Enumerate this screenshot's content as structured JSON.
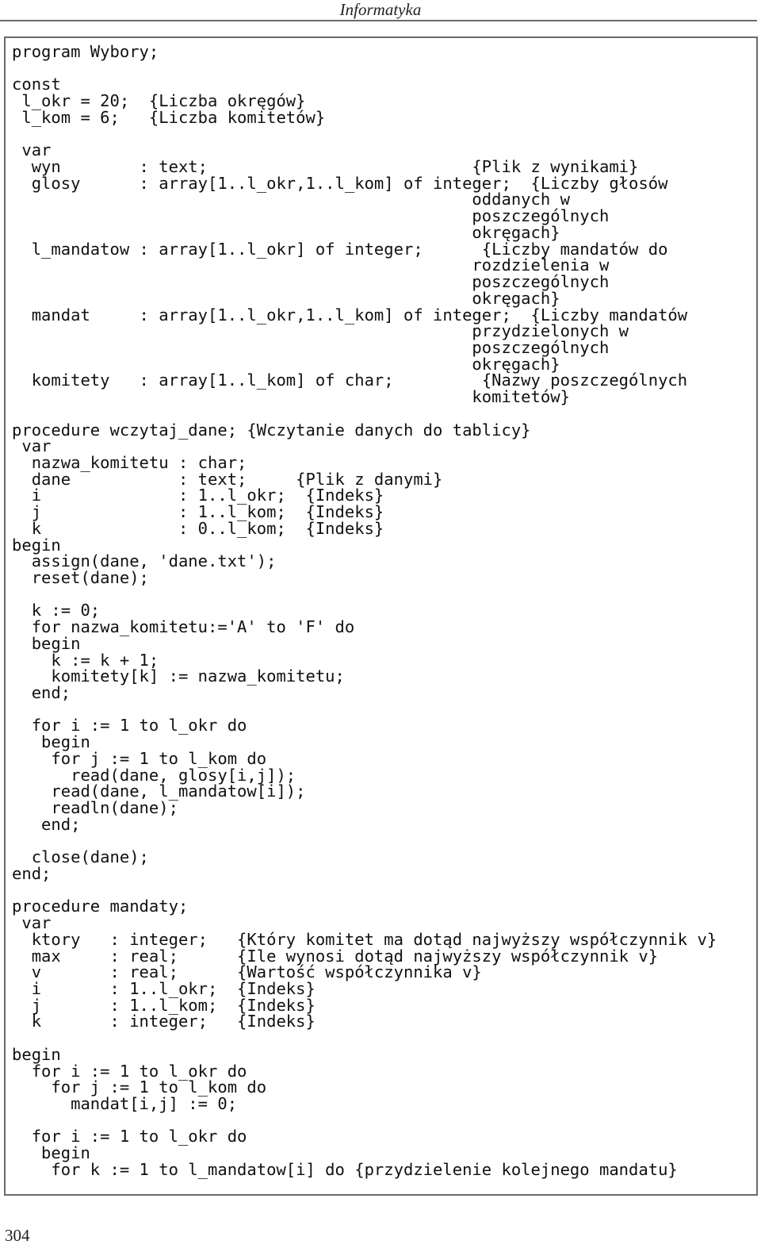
{
  "running_head": "Informatyka",
  "page_number": "304",
  "code_lines": [
    "program Wybory;",
    "",
    "const",
    " l_okr = 20;  {Liczba okręgów}",
    " l_kom = 6;   {Liczba komitetów}",
    "",
    " var",
    "  wyn        : text;                           {Plik z wynikami}",
    "  glosy      : array[1..l_okr,1..l_kom] of integer;  {Liczby głosów",
    "                                               oddanych w",
    "                                               poszczególnych",
    "                                               okręgach}",
    "  l_mandatow : array[1..l_okr] of integer;      {Liczby mandatów do",
    "                                               rozdzielenia w",
    "                                               poszczególnych",
    "                                               okręgach}",
    "  mandat     : array[1..l_okr,1..l_kom] of integer;  {Liczby mandatów",
    "                                               przydzielonych w",
    "                                               poszczególnych",
    "                                               okręgach}",
    "  komitety   : array[1..l_kom] of char;         {Nazwy poszczególnych",
    "                                               komitetów}",
    "",
    "procedure wczytaj_dane; {Wczytanie danych do tablicy}",
    " var",
    "  nazwa_komitetu : char;",
    "  dane           : text;     {Plik z danymi}",
    "  i              : 1..l_okr;  {Indeks}",
    "  j              : 1..l_kom;  {Indeks}",
    "  k              : 0..l_kom;  {Indeks}",
    "begin",
    "  assign(dane, 'dane.txt');",
    "  reset(dane);",
    "",
    "  k := 0;",
    "  for nazwa_komitetu:='A' to 'F' do",
    "  begin",
    "    k := k + 1;",
    "    komitety[k] := nazwa_komitetu;",
    "  end;",
    "",
    "  for i := 1 to l_okr do",
    "   begin",
    "    for j := 1 to l_kom do",
    "      read(dane, glosy[i,j]);",
    "    read(dane, l_mandatow[i]);",
    "    readln(dane);",
    "   end;",
    "",
    "  close(dane);",
    "end;",
    "",
    "procedure mandaty;",
    " var",
    "  ktory   : integer;   {Który komitet ma dotąd najwyższy współczynnik v}",
    "  max     : real;      {Ile wynosi dotąd najwyższy współczynnik v}",
    "  v       : real;      {Wartość współczynnika v}",
    "  i       : 1..l_okr;  {Indeks}",
    "  j       : 1..l_kom;  {Indeks}",
    "  k       : integer;   {Indeks}",
    "",
    "begin",
    "  for i := 1 to l_okr do",
    "    for j := 1 to l_kom do",
    "      mandat[i,j] := 0;",
    "",
    "  for i := 1 to l_okr do",
    "   begin",
    "    for k := 1 to l_mandatow[i] do {przydzielenie kolejnego mandatu}"
  ]
}
